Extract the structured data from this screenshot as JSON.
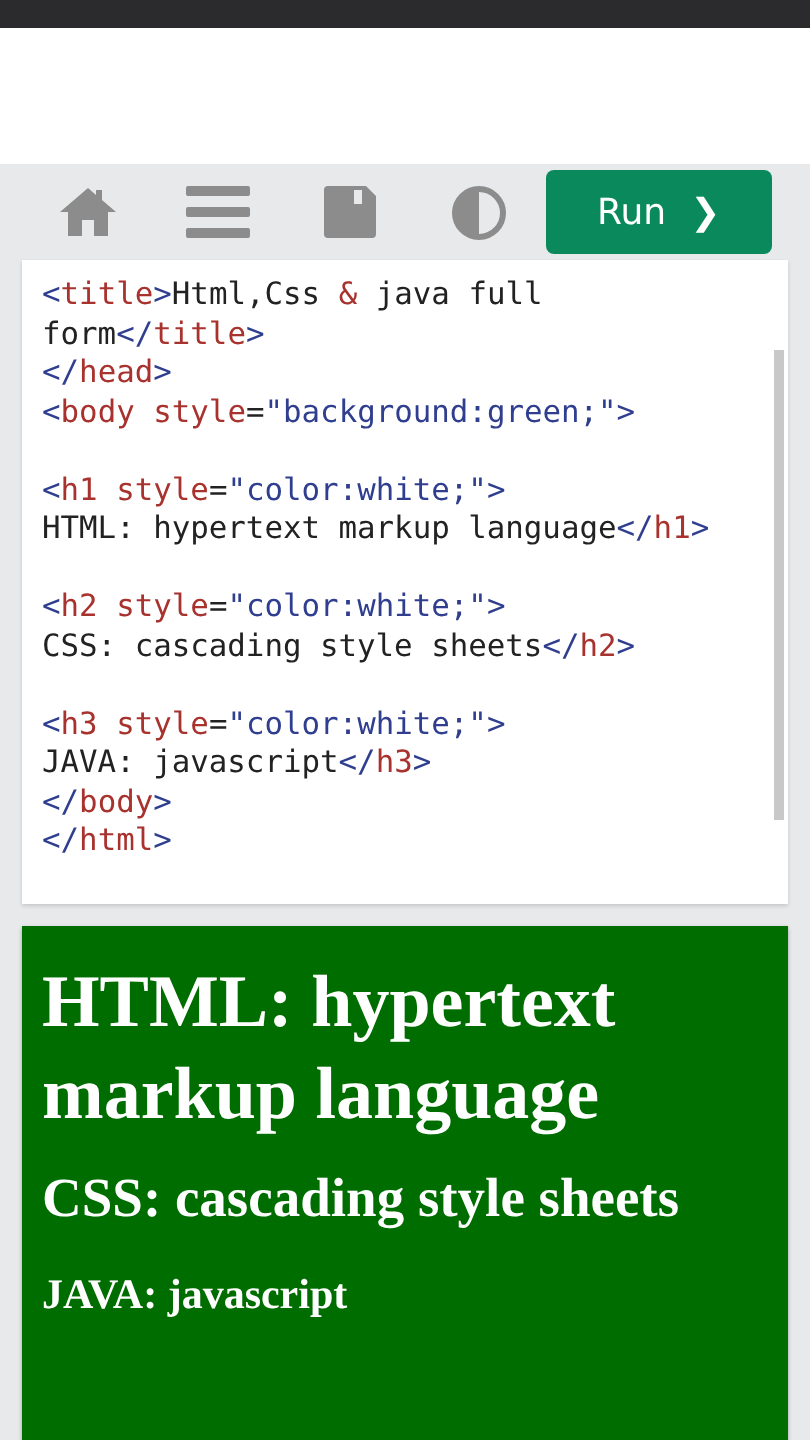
{
  "toolbar": {
    "buttons": [
      {
        "kind": "home"
      },
      {
        "kind": "menu"
      },
      {
        "kind": "save"
      },
      {
        "kind": "theme"
      }
    ],
    "run": {
      "label": "Run",
      "caret": "❯"
    }
  },
  "editor": {
    "lines": [
      {
        "kind": "code",
        "tokens": [
          {
            "kind": "punct",
            "text": "<"
          },
          {
            "kind": "name",
            "text": "title"
          },
          {
            "kind": "punct",
            "text": ">"
          },
          {
            "kind": "text",
            "text": "Html,Css "
          },
          {
            "kind": "name",
            "text": "&"
          },
          {
            "kind": "text",
            "text": " java full"
          }
        ]
      },
      {
        "kind": "code",
        "tokens": [
          {
            "kind": "text",
            "text": "form"
          },
          {
            "kind": "punct",
            "text": "</"
          },
          {
            "kind": "name",
            "text": "title"
          },
          {
            "kind": "punct",
            "text": ">"
          }
        ]
      },
      {
        "kind": "code",
        "tokens": [
          {
            "kind": "punct",
            "text": "</"
          },
          {
            "kind": "name",
            "text": "head"
          },
          {
            "kind": "punct",
            "text": ">"
          }
        ]
      },
      {
        "kind": "code",
        "tokens": [
          {
            "kind": "punct",
            "text": "<"
          },
          {
            "kind": "name",
            "text": "body"
          },
          {
            "kind": "name",
            "text": " style"
          },
          {
            "kind": "text",
            "text": "="
          },
          {
            "kind": "punct",
            "text": "\"background:green;\">"
          }
        ]
      },
      {
        "kind": "blank"
      },
      {
        "kind": "code",
        "tokens": [
          {
            "kind": "punct",
            "text": "<"
          },
          {
            "kind": "name",
            "text": "h1"
          },
          {
            "kind": "name",
            "text": " style"
          },
          {
            "kind": "text",
            "text": "="
          },
          {
            "kind": "punct",
            "text": "\"color:white;\">"
          }
        ]
      },
      {
        "kind": "code",
        "tokens": [
          {
            "kind": "text",
            "text": "HTML: hypertext markup language"
          },
          {
            "kind": "punct",
            "text": "</"
          },
          {
            "kind": "name",
            "text": "h1"
          },
          {
            "kind": "punct",
            "text": ">"
          }
        ]
      },
      {
        "kind": "blank"
      },
      {
        "kind": "code",
        "tokens": [
          {
            "kind": "punct",
            "text": "<"
          },
          {
            "kind": "name",
            "text": "h2"
          },
          {
            "kind": "name",
            "text": " style"
          },
          {
            "kind": "text",
            "text": "="
          },
          {
            "kind": "punct",
            "text": "\"color:white;\">"
          }
        ]
      },
      {
        "kind": "code",
        "tokens": [
          {
            "kind": "text",
            "text": "CSS: cascading style sheets"
          },
          {
            "kind": "punct",
            "text": "</"
          },
          {
            "kind": "name",
            "text": "h2"
          },
          {
            "kind": "punct",
            "text": ">"
          }
        ]
      },
      {
        "kind": "blank"
      },
      {
        "kind": "code",
        "tokens": [
          {
            "kind": "punct",
            "text": "<"
          },
          {
            "kind": "name",
            "text": "h3"
          },
          {
            "kind": "name",
            "text": " style"
          },
          {
            "kind": "text",
            "text": "="
          },
          {
            "kind": "punct",
            "text": "\"color:white;\">"
          }
        ]
      },
      {
        "kind": "code",
        "tokens": [
          {
            "kind": "text",
            "text": "JAVA: javascript"
          },
          {
            "kind": "punct",
            "text": "</"
          },
          {
            "kind": "name",
            "text": "h3"
          },
          {
            "kind": "punct",
            "text": ">"
          }
        ]
      },
      {
        "kind": "code",
        "tokens": [
          {
            "kind": "punct",
            "text": "</"
          },
          {
            "kind": "name",
            "text": "body"
          },
          {
            "kind": "punct",
            "text": ">"
          }
        ]
      },
      {
        "kind": "code",
        "tokens": [
          {
            "kind": "punct",
            "text": "</"
          },
          {
            "kind": "name",
            "text": "html"
          },
          {
            "kind": "punct",
            "text": ">"
          }
        ]
      }
    ]
  },
  "output": {
    "headings": [
      {
        "kind": "large",
        "text": "HTML: hypertext markup language"
      },
      {
        "kind": "medium",
        "text": "CSS: cascading style sheets"
      },
      {
        "kind": "small",
        "text": "JAVA: javascript"
      }
    ]
  }
}
